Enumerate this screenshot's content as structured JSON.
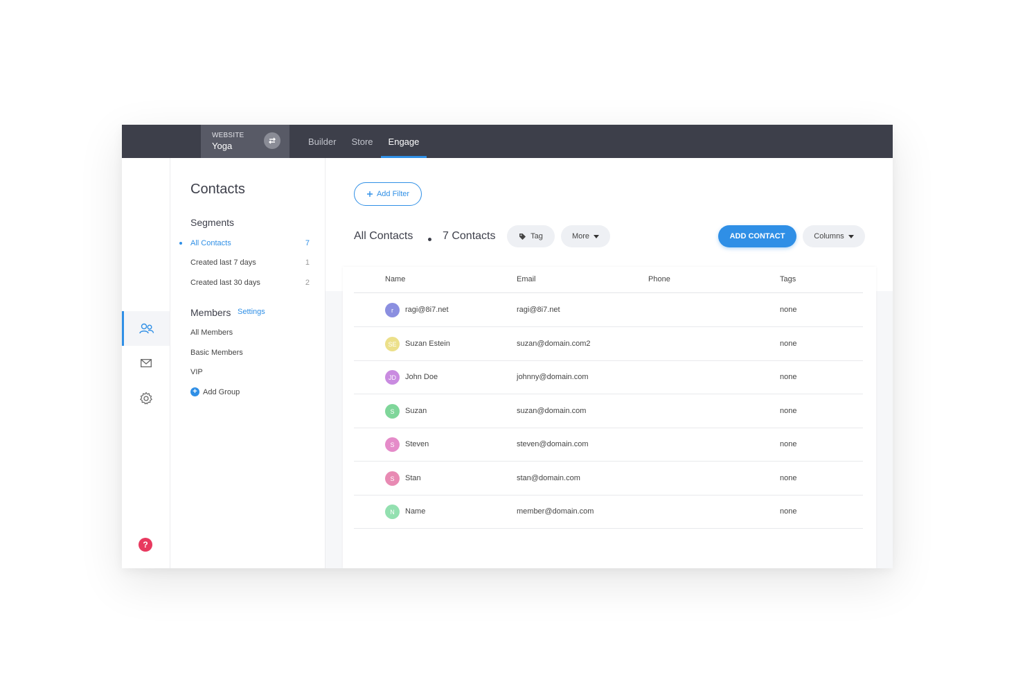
{
  "topbar": {
    "site_kind": "WEBSITE",
    "site_name": "Yoga",
    "nav": [
      "Builder",
      "Store",
      "Engage"
    ],
    "active_nav": "Engage"
  },
  "panel": {
    "title": "Contacts",
    "segments_title": "Segments",
    "segments": [
      {
        "label": "All Contacts",
        "count": "7",
        "active": true
      },
      {
        "label": "Created last 7 days",
        "count": "1",
        "active": false
      },
      {
        "label": "Created last 30 days",
        "count": "2",
        "active": false
      }
    ],
    "members_title": "Members",
    "settings_label": "Settings",
    "members": [
      "All Members",
      "Basic Members",
      "VIP"
    ],
    "add_group_label": "Add Group"
  },
  "main": {
    "add_filter_label": "Add Filter",
    "list_title": "All Contacts",
    "count_label": "7 Contacts",
    "tag_label": "Tag",
    "more_label": "More",
    "add_contact_label": "ADD CONTACT",
    "columns_label": "Columns"
  },
  "table": {
    "headers": [
      "Name",
      "Email",
      "Phone",
      "Tags"
    ],
    "rows": [
      {
        "initials": "r",
        "avatar_color": "#8b8fe0",
        "name": "ragi@8i7.net",
        "email": "ragi@8i7.net",
        "phone": "",
        "tags": "none"
      },
      {
        "initials": "SE",
        "avatar_color": "#ece08a",
        "name": "Suzan Estein",
        "email": "suzan@domain.com2",
        "phone": "",
        "tags": "none"
      },
      {
        "initials": "JD",
        "avatar_color": "#c98be0",
        "name": "John Doe",
        "email": "johnny@domain.com",
        "phone": "",
        "tags": "none"
      },
      {
        "initials": "S",
        "avatar_color": "#7fd69a",
        "name": "Suzan",
        "email": "suzan@domain.com",
        "phone": "",
        "tags": "none"
      },
      {
        "initials": "S",
        "avatar_color": "#e58bc9",
        "name": "Steven",
        "email": "steven@domain.com",
        "phone": "",
        "tags": "none"
      },
      {
        "initials": "S",
        "avatar_color": "#e88ab3",
        "name": "Stan",
        "email": "stan@domain.com",
        "phone": "",
        "tags": "none"
      },
      {
        "initials": "N",
        "avatar_color": "#93e0b0",
        "name": "Name",
        "email": "member@domain.com",
        "phone": "",
        "tags": "none"
      }
    ]
  },
  "rail": {
    "items": [
      "contacts-icon",
      "mail-icon",
      "settings-icon"
    ],
    "active": "contacts-icon",
    "help_glyph": "?"
  },
  "colors": {
    "accent": "#2f8fe6",
    "topbar": "#3d3f4a",
    "help": "#e8395f"
  }
}
